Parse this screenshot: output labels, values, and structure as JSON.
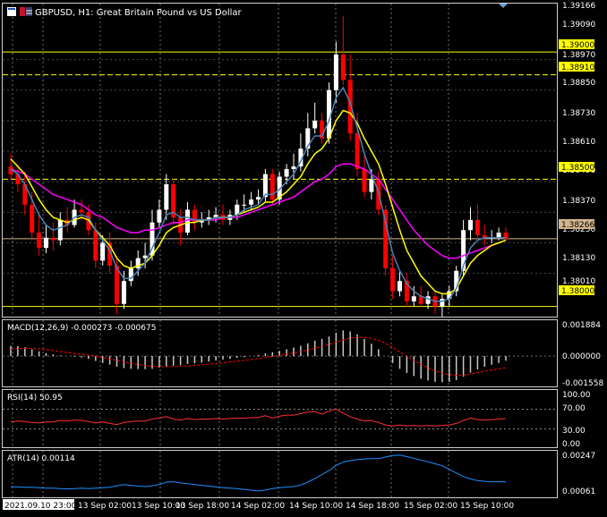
{
  "header": {
    "symbol_title": "GBPUSD, H1:  Great Britain Pound vs US Dollar"
  },
  "price_axis": {
    "ticks": [
      "1.39166",
      "1.39090",
      "1.38970",
      "1.38850",
      "1.38730",
      "1.38610",
      "1.38490",
      "1.38370",
      "1.38250",
      "1.38130",
      "1.38010"
    ],
    "level_labels": [
      "1.39000",
      "1.38910",
      "1.38500",
      "1.38000"
    ],
    "current_price_label": "1.38266"
  },
  "macd": {
    "label": "MACD(12,26,9) -0.000273 -0.000675",
    "axis": [
      "0.001884",
      "0.000000",
      "-0.001558"
    ]
  },
  "rsi": {
    "label": "RSI(14) 50.95",
    "axis": [
      "100.00",
      "70.00",
      "30.00",
      "0.00"
    ]
  },
  "atr": {
    "label": "ATR(14) 0.00114",
    "axis": [
      "0.00247",
      "0.00061"
    ]
  },
  "time_axis": {
    "labels": [
      "2021.09.10 23:00",
      "13 Sep 02:00",
      "13 Sep 10:00",
      "13 Sep 18:00",
      "14 Sep 02:00",
      "14 Sep 10:00",
      "14 Sep 18:00",
      "15 Sep 02:00",
      "15 Sep 10:00"
    ]
  },
  "colors": {
    "bull": "#ffffff",
    "bear": "#ff0000",
    "ma_fast": "#ffff00",
    "ma_mid": "#4682b4",
    "ma_slow": "#ff00ff",
    "level_line": "#ffff00",
    "macd_signal": "#ff0000",
    "rsi": "#ff3030",
    "atr": "#1e90ff"
  },
  "chart_data": {
    "type": "candlestick",
    "opens": [
      1.3855,
      1.3852,
      1.3848,
      1.384,
      1.3829,
      1.3823,
      1.3827,
      1.3826,
      1.3834,
      1.3832,
      1.3838,
      1.3837,
      1.383,
      1.3818,
      1.3825,
      1.3816,
      1.3801,
      1.381,
      1.3815,
      1.3819,
      1.382,
      1.3833,
      1.3838,
      1.3848,
      1.3835,
      1.3829,
      1.3838,
      1.3833,
      1.3834,
      1.3835,
      1.3836,
      1.3834,
      1.3836,
      1.384,
      1.384,
      1.3842,
      1.3843,
      1.3852,
      1.3842,
      1.3851,
      1.3854,
      1.3855,
      1.3862,
      1.387,
      1.3873,
      1.3866,
      1.3885,
      1.3899,
      1.3889,
      1.3868,
      1.3854,
      1.3845,
      1.385,
      1.3838,
      1.3815,
      1.3806,
      1.381,
      1.3802,
      1.3804,
      1.3801,
      1.3804,
      1.38,
      1.3803,
      1.3806,
      1.3814,
      1.383,
      1.3834,
      1.3828,
      1.3827,
      1.3827,
      1.3829
    ],
    "closes": [
      1.3852,
      1.3848,
      1.384,
      1.3829,
      1.3823,
      1.3827,
      1.3826,
      1.3834,
      1.3832,
      1.3838,
      1.3837,
      1.383,
      1.3818,
      1.3825,
      1.3816,
      1.3801,
      1.381,
      1.3815,
      1.3819,
      1.382,
      1.3833,
      1.3838,
      1.3848,
      1.3835,
      1.3829,
      1.3838,
      1.3833,
      1.3834,
      1.3835,
      1.3836,
      1.3834,
      1.3836,
      1.384,
      1.384,
      1.3842,
      1.3843,
      1.3852,
      1.3842,
      1.3851,
      1.3854,
      1.3855,
      1.3862,
      1.387,
      1.3873,
      1.3866,
      1.3885,
      1.3899,
      1.3889,
      1.3868,
      1.3854,
      1.3845,
      1.385,
      1.3838,
      1.3815,
      1.3806,
      1.381,
      1.3802,
      1.3804,
      1.3801,
      1.3804,
      1.38,
      1.3803,
      1.3806,
      1.3814,
      1.383,
      1.3834,
      1.3828,
      1.3827,
      1.3827,
      1.3829,
      1.38266
    ],
    "highs": [
      1.386,
      1.3856,
      1.3853,
      1.3845,
      1.3836,
      1.3832,
      1.3833,
      1.3837,
      1.3839,
      1.3842,
      1.3842,
      1.384,
      1.3833,
      1.3828,
      1.3829,
      1.382,
      1.3814,
      1.3818,
      1.3822,
      1.3825,
      1.3838,
      1.3842,
      1.3852,
      1.385,
      1.3838,
      1.3841,
      1.384,
      1.3837,
      1.3838,
      1.3839,
      1.384,
      1.3838,
      1.3842,
      1.3844,
      1.3845,
      1.3846,
      1.3854,
      1.3854,
      1.3853,
      1.3856,
      1.386,
      1.3868,
      1.3876,
      1.388,
      1.3876,
      1.3888,
      1.3904,
      1.3914,
      1.3899,
      1.3876,
      1.386,
      1.3854,
      1.3853,
      1.384,
      1.382,
      1.3814,
      1.3813,
      1.3808,
      1.3808,
      1.3806,
      1.3806,
      1.3805,
      1.3808,
      1.3816,
      1.3834,
      1.3839,
      1.384,
      1.3832,
      1.383,
      1.3831,
      1.3831
    ],
    "lows": [
      1.385,
      1.3845,
      1.3836,
      1.3826,
      1.382,
      1.3821,
      1.3822,
      1.3824,
      1.3829,
      1.3831,
      1.3834,
      1.3828,
      1.3815,
      1.3816,
      1.3813,
      1.3797,
      1.3799,
      1.3808,
      1.3812,
      1.3815,
      1.3818,
      1.3831,
      1.3834,
      1.3832,
      1.3824,
      1.3828,
      1.383,
      1.3831,
      1.3832,
      1.3833,
      1.3832,
      1.3832,
      1.3834,
      1.3837,
      1.3838,
      1.384,
      1.3841,
      1.384,
      1.384,
      1.3848,
      1.385,
      1.3853,
      1.3859,
      1.3868,
      1.3864,
      1.3864,
      1.388,
      1.3887,
      1.3865,
      1.3851,
      1.3843,
      1.3842,
      1.3836,
      1.3812,
      1.3803,
      1.3804,
      1.38,
      1.38,
      1.38,
      1.3799,
      1.3797,
      1.3795,
      1.38,
      1.3804,
      1.3812,
      1.3826,
      1.3826,
      1.3824,
      1.3825,
      1.3826,
      1.3826
    ],
    "ma_fast": [
      1.3858,
      1.3855,
      1.3852,
      1.3847,
      1.3842,
      1.3838,
      1.3835,
      1.3834,
      1.3833,
      1.3834,
      1.3835,
      1.3834,
      1.383,
      1.3827,
      1.3824,
      1.3819,
      1.3816,
      1.3815,
      1.3816,
      1.3817,
      1.382,
      1.3824,
      1.3829,
      1.3831,
      1.3832,
      1.3833,
      1.3833,
      1.3834,
      1.3834,
      1.3835,
      1.3835,
      1.3835,
      1.3836,
      1.3837,
      1.3838,
      1.3839,
      1.3841,
      1.3841,
      1.3843,
      1.3845,
      1.3848,
      1.3851,
      1.3856,
      1.386,
      1.3862,
      1.3866,
      1.3873,
      1.3877,
      1.3876,
      1.3872,
      1.3866,
      1.3861,
      1.3856,
      1.3848,
      1.3839,
      1.383,
      1.3822,
      1.3817,
      1.3812,
      1.3809,
      1.3806,
      1.3805,
      1.3805,
      1.3807,
      1.3812,
      1.3817,
      1.382,
      1.3822,
      1.3824,
      1.3825,
      1.3826
    ],
    "ma_mid": [
      1.3854,
      1.3852,
      1.3848,
      1.3842,
      1.3836,
      1.3832,
      1.383,
      1.3831,
      1.3832,
      1.3835,
      1.3836,
      1.3835,
      1.383,
      1.3826,
      1.3822,
      1.3815,
      1.3811,
      1.3811,
      1.3814,
      1.3817,
      1.3823,
      1.3829,
      1.3836,
      1.3837,
      1.3835,
      1.3835,
      1.3834,
      1.3834,
      1.3834,
      1.3835,
      1.3835,
      1.3835,
      1.3836,
      1.3838,
      1.3839,
      1.384,
      1.3844,
      1.3844,
      1.3846,
      1.3849,
      1.3852,
      1.3857,
      1.3863,
      1.3867,
      1.3867,
      1.3873,
      1.3882,
      1.3886,
      1.388,
      1.387,
      1.386,
      1.3852,
      1.3845,
      1.3833,
      1.3821,
      1.3814,
      1.3809,
      1.3806,
      1.3804,
      1.3803,
      1.3802,
      1.3802,
      1.3803,
      1.3807,
      1.3816,
      1.3823,
      1.3826,
      1.3827,
      1.3827,
      1.3827,
      1.3827
    ],
    "ma_slow": [
      1.3854,
      1.3853,
      1.3852,
      1.385,
      1.3848,
      1.3846,
      1.3844,
      1.3843,
      1.3842,
      1.3841,
      1.384,
      1.3838,
      1.3836,
      1.3835,
      1.3833,
      1.3831,
      1.383,
      1.3829,
      1.3829,
      1.383,
      1.383,
      1.3831,
      1.3832,
      1.3833,
      1.3833,
      1.3834,
      1.3834,
      1.3834,
      1.3834,
      1.3834,
      1.3835,
      1.3835,
      1.3835,
      1.3836,
      1.3837,
      1.3838,
      1.3839,
      1.384,
      1.3841,
      1.3842,
      1.3843,
      1.3845,
      1.3847,
      1.3849,
      1.385,
      1.3852,
      1.3855,
      1.3856,
      1.3856,
      1.3855,
      1.3854,
      1.3852,
      1.385,
      1.3846,
      1.3842,
      1.3838,
      1.3834,
      1.383,
      1.3827,
      1.3824,
      1.3822,
      1.382,
      1.3819,
      1.3819,
      1.382,
      1.3821,
      1.3822,
      1.3823,
      1.3824,
      1.3825,
      1.3826
    ],
    "levels": [
      1.39,
      1.3891,
      1.385,
      1.38
    ],
    "current_price": 1.38266,
    "price_range": [
      1.3796,
      1.3919
    ],
    "macd_hist": [
      0.0006,
      0.00058,
      0.00052,
      0.0004,
      0.00028,
      0.00018,
      0.0001,
      4e-05,
      0.0,
      -4e-05,
      -8e-05,
      -0.00016,
      -0.00028,
      -0.0004,
      -0.0005,
      -0.00062,
      -0.0007,
      -0.00074,
      -0.00076,
      -0.00076,
      -0.00074,
      -0.00068,
      -0.0006,
      -0.00056,
      -0.00052,
      -0.00046,
      -0.00042,
      -0.00038,
      -0.00032,
      -0.00026,
      -0.0002,
      -0.00016,
      -0.0001,
      -6e-05,
      0.0,
      6e-05,
      0.00016,
      0.00022,
      0.0003,
      0.0004,
      0.0005,
      0.0006,
      0.00074,
      0.0009,
      0.001,
      0.00114,
      0.00136,
      0.0015,
      0.00144,
      0.00126,
      0.001,
      0.00072,
      0.0004,
      0.0,
      -0.0004,
      -0.00074,
      -0.00098,
      -0.00116,
      -0.00132,
      -0.00142,
      -0.0015,
      -0.00152,
      -0.0015,
      -0.0014,
      -0.0012,
      -0.00096,
      -0.00078,
      -0.00062,
      -0.0005,
      -0.0004,
      -0.00027
    ],
    "macd_signal": [
      0.0004,
      0.00044,
      0.00046,
      0.00045,
      0.00042,
      0.00037,
      0.00032,
      0.00026,
      0.00021,
      0.00016,
      0.00011,
      6e-05,
      0.0,
      -8e-05,
      -0.00016,
      -0.00025,
      -0.00034,
      -0.00042,
      -0.00049,
      -0.00055,
      -0.00059,
      -0.00062,
      -0.00062,
      -0.00061,
      -0.00059,
      -0.00057,
      -0.00054,
      -0.00051,
      -0.00047,
      -0.00043,
      -0.00039,
      -0.00034,
      -0.00029,
      -0.00025,
      -0.0002,
      -0.00014,
      -8e-05,
      -2e-05,
      4e-05,
      0.00011,
      0.00018,
      0.00026,
      0.00035,
      0.00046,
      0.00057,
      0.00068,
      0.00082,
      0.00095,
      0.00105,
      0.0011,
      0.0011,
      0.00104,
      0.00092,
      0.00074,
      0.0005,
      0.00024,
      0.0,
      -0.00025,
      -0.00048,
      -0.00068,
      -0.00086,
      -0.001,
      -0.00108,
      -0.00112,
      -0.0011,
      -0.00104,
      -0.00096,
      -0.00088,
      -0.0008,
      -0.00074,
      -0.00068
    ],
    "macd_range": [
      -0.001558,
      0.001884
    ],
    "rsi": [
      44,
      46,
      45,
      43,
      42,
      44,
      44,
      47,
      46,
      48,
      47,
      45,
      42,
      44,
      41,
      39,
      43,
      45,
      46,
      46,
      50,
      52,
      55,
      50,
      48,
      51,
      49,
      50,
      50,
      51,
      50,
      51,
      52,
      52,
      53,
      53,
      57,
      52,
      56,
      58,
      58,
      61,
      64,
      65,
      60,
      66,
      70,
      62,
      55,
      50,
      46,
      47,
      43,
      38,
      36,
      38,
      36,
      37,
      36,
      37,
      36,
      37,
      38,
      41,
      47,
      52,
      49,
      48,
      49,
      50,
      50.95
    ],
    "rsi_range": [
      0,
      100
    ],
    "atr": [
      0.0009,
      0.00088,
      0.00086,
      0.00086,
      0.00084,
      0.00082,
      0.00082,
      0.0008,
      0.00078,
      0.0008,
      0.00082,
      0.0008,
      0.00082,
      0.00084,
      0.00086,
      0.00094,
      0.001,
      0.00096,
      0.00092,
      0.0009,
      0.00094,
      0.001,
      0.00112,
      0.00114,
      0.00108,
      0.00104,
      0.001,
      0.00096,
      0.00092,
      0.00088,
      0.00084,
      0.00082,
      0.0008,
      0.00076,
      0.00072,
      0.00068,
      0.00072,
      0.0008,
      0.00084,
      0.00088,
      0.0009,
      0.00098,
      0.00112,
      0.0013,
      0.0015,
      0.0017,
      0.00196,
      0.00212,
      0.0022,
      0.00225,
      0.00228,
      0.0023,
      0.0023,
      0.00238,
      0.00245,
      0.00247,
      0.0024,
      0.00232,
      0.00222,
      0.00214,
      0.00204,
      0.00194,
      0.00176,
      0.00158,
      0.0014,
      0.00128,
      0.0012,
      0.00116,
      0.00114,
      0.00114,
      0.00114
    ],
    "atr_range": [
      0.00045,
      0.0026
    ]
  }
}
